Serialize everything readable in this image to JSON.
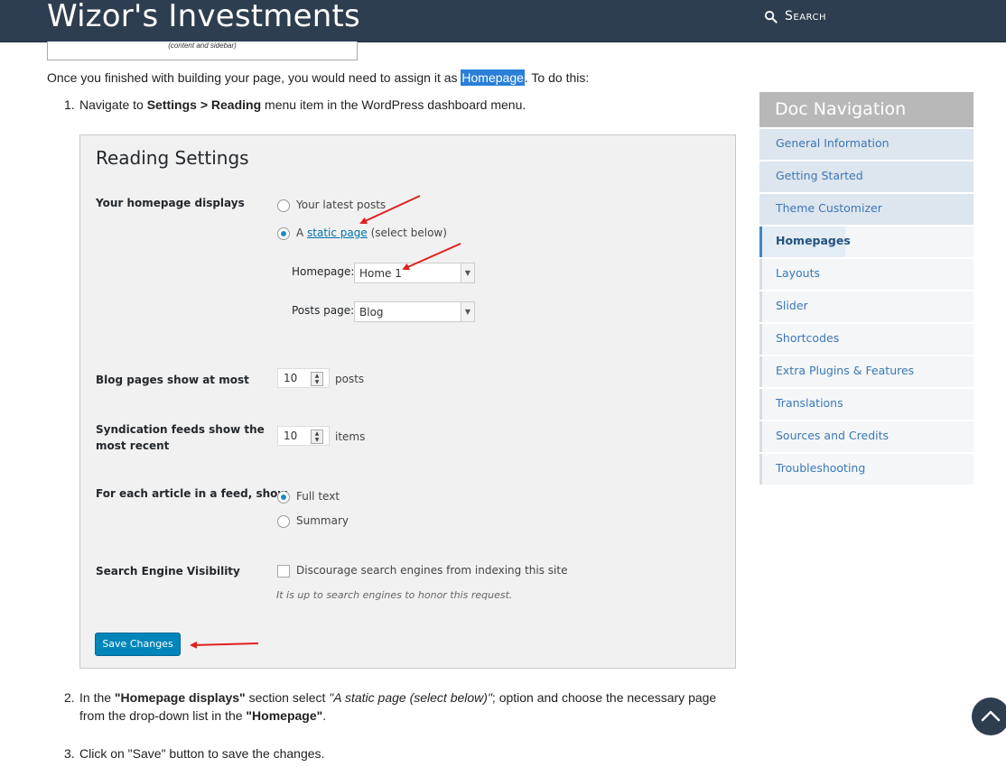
{
  "header": {
    "site_title": "Wizor's Investments",
    "search_label": "Search"
  },
  "previous_figure": {
    "caption": "(content and sidebar)"
  },
  "intro": {
    "before": "Once you finished with building your page, you would need to assign it as ",
    "highlight": "Homepage",
    "after": ". To do this:"
  },
  "steps": {
    "s1": {
      "num": "1.",
      "pre": "Navigate to ",
      "bold": "Settings > Reading",
      "post": " menu item in the WordPress dashboard menu."
    },
    "s2": {
      "num": "2.",
      "t1": "In the ",
      "b1": "\"Homepage displays\"",
      "t2": " section select ",
      "i1": "\"A static page (select below)\"",
      "t3": "; option and choose the necessary page",
      "t4": "from the drop-down list in the ",
      "b2": "\"Homepage\"",
      "t5": "."
    },
    "s3": {
      "num": "3.",
      "text": "Click on \"Save\" button to save the changes."
    }
  },
  "reading_settings": {
    "title": "Reading Settings",
    "homepage_displays_label": "Your homepage displays",
    "opt_latest": "Your latest posts",
    "opt_static_prefix": "A ",
    "opt_static_link": "static page",
    "opt_static_suffix": " (select below)",
    "homepage_label": "Homepage:",
    "homepage_value": "Home 1",
    "posts_page_label": "Posts page:",
    "posts_page_value": "Blog",
    "blog_pages_label": "Blog pages show at most",
    "blog_pages_value": "10",
    "blog_pages_unit": "posts",
    "feeds_label_1": "Syndication feeds show the",
    "feeds_label_2": "most recent",
    "feeds_value": "10",
    "feeds_unit": "items",
    "feed_article_label": "For each article in a feed, show",
    "opt_full_text": "Full text",
    "opt_summary": "Summary",
    "sev_label": "Search Engine Visibility",
    "sev_checkbox": "Discourage search engines from indexing this site",
    "sev_hint": "It is up to search engines to honor this request.",
    "save_button": "Save Changes"
  },
  "doc_nav": {
    "heading": "Doc Navigation",
    "items": [
      "General Information",
      "Getting Started",
      "Theme Customizer",
      "Homepages",
      "Layouts",
      "Slider",
      "Shortcodes",
      "Extra Plugins & Features",
      "Translations",
      "Sources and Credits",
      "Troubleshooting"
    ],
    "active": "Homepages"
  },
  "colors": {
    "header_bg": "#2d3e50",
    "highlight": "#2b7fd8",
    "link": "#3a78b5",
    "wp_button": "#0085ba",
    "annotation_arrow": "#e0201b"
  },
  "icons": [
    "search-icon",
    "chevron-up-icon",
    "dropdown-arrow-icon",
    "spinner-icon"
  ]
}
